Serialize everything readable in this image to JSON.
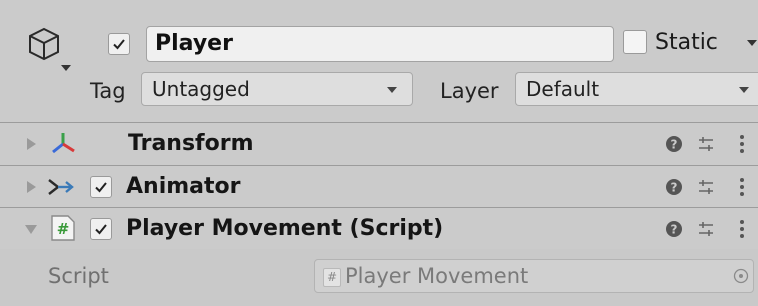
{
  "gameobject": {
    "active_checked": true,
    "name": "Player",
    "static_label": "Static",
    "static_checked": false,
    "tag_label": "Tag",
    "tag_value": "Untagged",
    "layer_label": "Layer",
    "layer_value": "Default"
  },
  "components": [
    {
      "title": "Transform",
      "expanded": false,
      "icon": "transform-axes-icon",
      "has_checkbox": false
    },
    {
      "title": "Animator",
      "expanded": false,
      "icon": "animator-icon",
      "has_checkbox": true,
      "checked": true
    },
    {
      "title": "Player Movement (Script)",
      "expanded": true,
      "icon": "script-hash-icon",
      "has_checkbox": true,
      "checked": true
    }
  ],
  "script_field": {
    "label": "Script",
    "value": "Player Movement"
  },
  "colors": {
    "panel_bg": "#cbcbcb",
    "field_bg": "#f0f0f0",
    "script_icon_green": "#3a9a3a",
    "transform_red": "#d83a3a",
    "transform_green": "#3aa04a",
    "transform_blue": "#3a6ad8"
  }
}
